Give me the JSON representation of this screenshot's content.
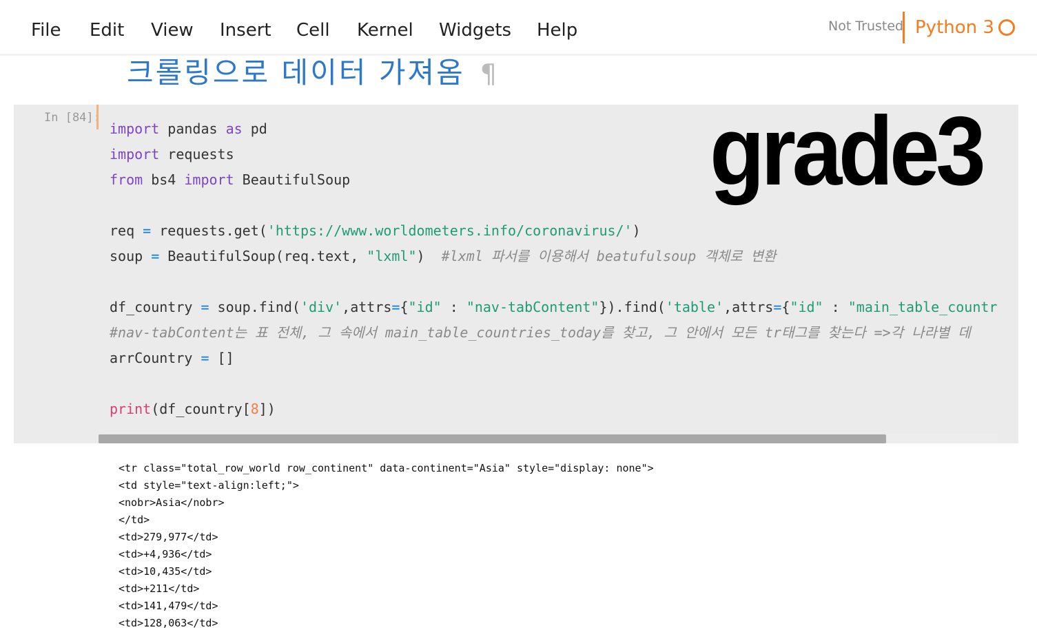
{
  "menubar": {
    "items": [
      "File",
      "Edit",
      "View",
      "Insert",
      "Cell",
      "Kernel",
      "Widgets",
      "Help"
    ],
    "trust_status": "Not Trusted",
    "kernel_name": "Python 3",
    "kernel_indicator_icon": "kernel-idle-circle-icon"
  },
  "heading": {
    "text": "크롤링으로 데이터 가져옴",
    "anchor": "¶"
  },
  "watermark": "grade3",
  "cell": {
    "prompt": "In [84]:",
    "lines": [
      [
        {
          "t": "import",
          "c": "kw"
        },
        {
          "t": " pandas ",
          "c": ""
        },
        {
          "t": "as",
          "c": "kw"
        },
        {
          "t": " pd",
          "c": ""
        }
      ],
      [
        {
          "t": "import",
          "c": "kw"
        },
        {
          "t": " requests",
          "c": ""
        }
      ],
      [
        {
          "t": "from",
          "c": "kw"
        },
        {
          "t": " bs4 ",
          "c": ""
        },
        {
          "t": "import",
          "c": "kw"
        },
        {
          "t": " BeautifulSoup",
          "c": ""
        }
      ],
      [],
      [
        {
          "t": "req ",
          "c": ""
        },
        {
          "t": "=",
          "c": "op"
        },
        {
          "t": " requests.get(",
          "c": ""
        },
        {
          "t": "'https://www.worldometers.info/coronavirus/'",
          "c": "str"
        },
        {
          "t": ")",
          "c": ""
        }
      ],
      [
        {
          "t": "soup ",
          "c": ""
        },
        {
          "t": "=",
          "c": "op"
        },
        {
          "t": " BeautifulSoup(req.text, ",
          "c": ""
        },
        {
          "t": "\"lxml\"",
          "c": "str"
        },
        {
          "t": ")  ",
          "c": ""
        },
        {
          "t": "#lxml 파서를 이용해서 beatufulsoup 객체로 변환",
          "c": "cm"
        }
      ],
      [],
      [
        {
          "t": "df_country ",
          "c": ""
        },
        {
          "t": "=",
          "c": "op"
        },
        {
          "t": " soup.find(",
          "c": ""
        },
        {
          "t": "'div'",
          "c": "str"
        },
        {
          "t": ",attrs",
          "c": ""
        },
        {
          "t": "=",
          "c": "op"
        },
        {
          "t": "{",
          "c": ""
        },
        {
          "t": "\"id\"",
          "c": "str"
        },
        {
          "t": " : ",
          "c": ""
        },
        {
          "t": "\"nav-tabContent\"",
          "c": "str"
        },
        {
          "t": "}).find(",
          "c": ""
        },
        {
          "t": "'table'",
          "c": "str"
        },
        {
          "t": ",attrs",
          "c": ""
        },
        {
          "t": "=",
          "c": "op"
        },
        {
          "t": "{",
          "c": ""
        },
        {
          "t": "\"id\"",
          "c": "str"
        },
        {
          "t": " : ",
          "c": ""
        },
        {
          "t": "\"main_table_countries_today\"",
          "c": "str"
        }
      ],
      [
        {
          "t": "#nav-tabContent는 표 전체, 그 속에서 main_table_countries_today를 찾고, 그 안에서 모든 tr태그를 찾는다 =>각 나라별 데",
          "c": "cm"
        }
      ],
      [
        {
          "t": "arrCountry ",
          "c": ""
        },
        {
          "t": "=",
          "c": "op"
        },
        {
          "t": " []",
          "c": ""
        }
      ],
      [],
      [
        {
          "t": "print",
          "c": "fn"
        },
        {
          "t": "(df_country[",
          "c": ""
        },
        {
          "t": "8",
          "c": "num"
        },
        {
          "t": "])",
          "c": ""
        }
      ]
    ]
  },
  "output": {
    "lines": [
      "<tr class=\"total_row_world row_continent\" data-continent=\"Asia\" style=\"display: none\">",
      "<td style=\"text-align:left;\">",
      "<nobr>Asia</nobr>",
      "</td>",
      "<td>279,977</td>",
      "<td>+4,936</td>",
      "<td>10,435</td>",
      "<td>+211</td>",
      "<td>141,479</td>",
      "<td>128,063</td>"
    ]
  },
  "colors": {
    "accent": "#f57c1f",
    "heading": "#2d78c8",
    "keyword": "#7d45c4",
    "string": "#1f9b75",
    "operator": "#0b7fd8",
    "comment": "#8a8a8a",
    "number": "#f07f4a",
    "builtin": "#d43f76"
  }
}
